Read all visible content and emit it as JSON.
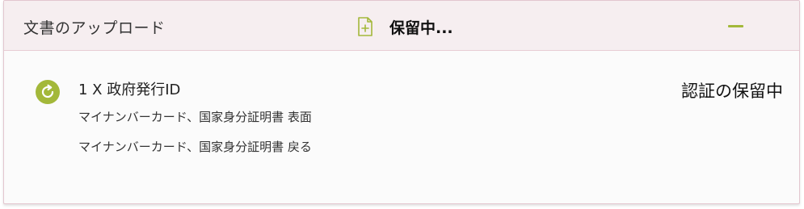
{
  "header": {
    "title": "文書のアップロード",
    "status": "保留中...",
    "doc_icon": "document-plus-icon",
    "collapse_icon": "minus-icon"
  },
  "item": {
    "icon": "refresh-pending-icon",
    "title": "1 X 政府発行ID",
    "lines": [
      "マイナンバーカード、国家身分証明書 表面",
      "マイナンバーカード、国家身分証明書 戻る"
    ],
    "status": "認証の保留中"
  },
  "colors": {
    "accent": "#a3b83a",
    "header_bg": "#f6eef0",
    "border": "#e3c6cf"
  }
}
